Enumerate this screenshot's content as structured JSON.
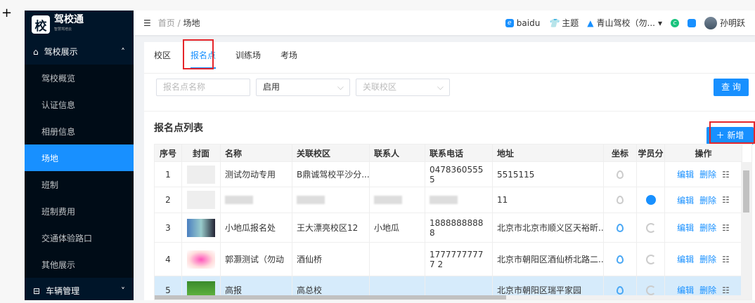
{
  "logo": {
    "mark": "校",
    "name": "驾校通",
    "tagline": "智慧驾培云"
  },
  "sidebar": {
    "group1": "驾校展示",
    "items": [
      "驾校概览",
      "认证信息",
      "相册信息",
      "场地",
      "班制",
      "班制费用",
      "交通体验路口",
      "其他展示"
    ],
    "active": 3,
    "group2": "车辆管理"
  },
  "header": {
    "breadcrumb_home": "首页",
    "breadcrumb_sep": "/",
    "breadcrumb_current": "场地",
    "baidu": "baidu",
    "theme": "主题",
    "school": "青山驾校（勿...",
    "user": "孙明跃"
  },
  "tabs": [
    "校区",
    "报名点",
    "训练场",
    "考场"
  ],
  "filters": {
    "name_placeholder": "报名点名称",
    "status": "启用",
    "campus_placeholder": "关联校区",
    "query": "查 询"
  },
  "list": {
    "title": "报名点列表",
    "add": "新增"
  },
  "table": {
    "columns": [
      "序号",
      "封面",
      "名称",
      "关联校区",
      "联系人",
      "联系电话",
      "地址",
      "坐标",
      "学员分",
      "操作"
    ],
    "rows": [
      {
        "no": "1",
        "name": "测试勿动专用",
        "campus": "B鼎诚驾校平沙分...",
        "contact": "",
        "phone": "04783605555",
        "address": "5515115"
      },
      {
        "no": "2",
        "name": "",
        "campus": "",
        "contact": "",
        "phone": "",
        "address": "11"
      },
      {
        "no": "3",
        "name": "小地瓜报名处",
        "campus": "王大漂亮校区12",
        "contact": "小地瓜",
        "phone": "18888888888",
        "address": "北京市北京市顺义区天裕昕..."
      },
      {
        "no": "4",
        "name": "郭灏测试（勿动",
        "campus": "酒仙桥",
        "contact": "",
        "phone": "17777777777 2",
        "address": "北京市朝阳区酒仙桥北路二..."
      },
      {
        "no": "5",
        "name": "高报",
        "campus": "高总校",
        "contact": "",
        "phone": "",
        "address": "北京市朝阳区瑞平家园"
      }
    ],
    "actions": {
      "edit": "编辑",
      "delete": "删除",
      "qr": "☷"
    }
  },
  "colors": {
    "primary": "#1890ff",
    "sidebar": "#001529",
    "highlight": "#e5252a"
  }
}
